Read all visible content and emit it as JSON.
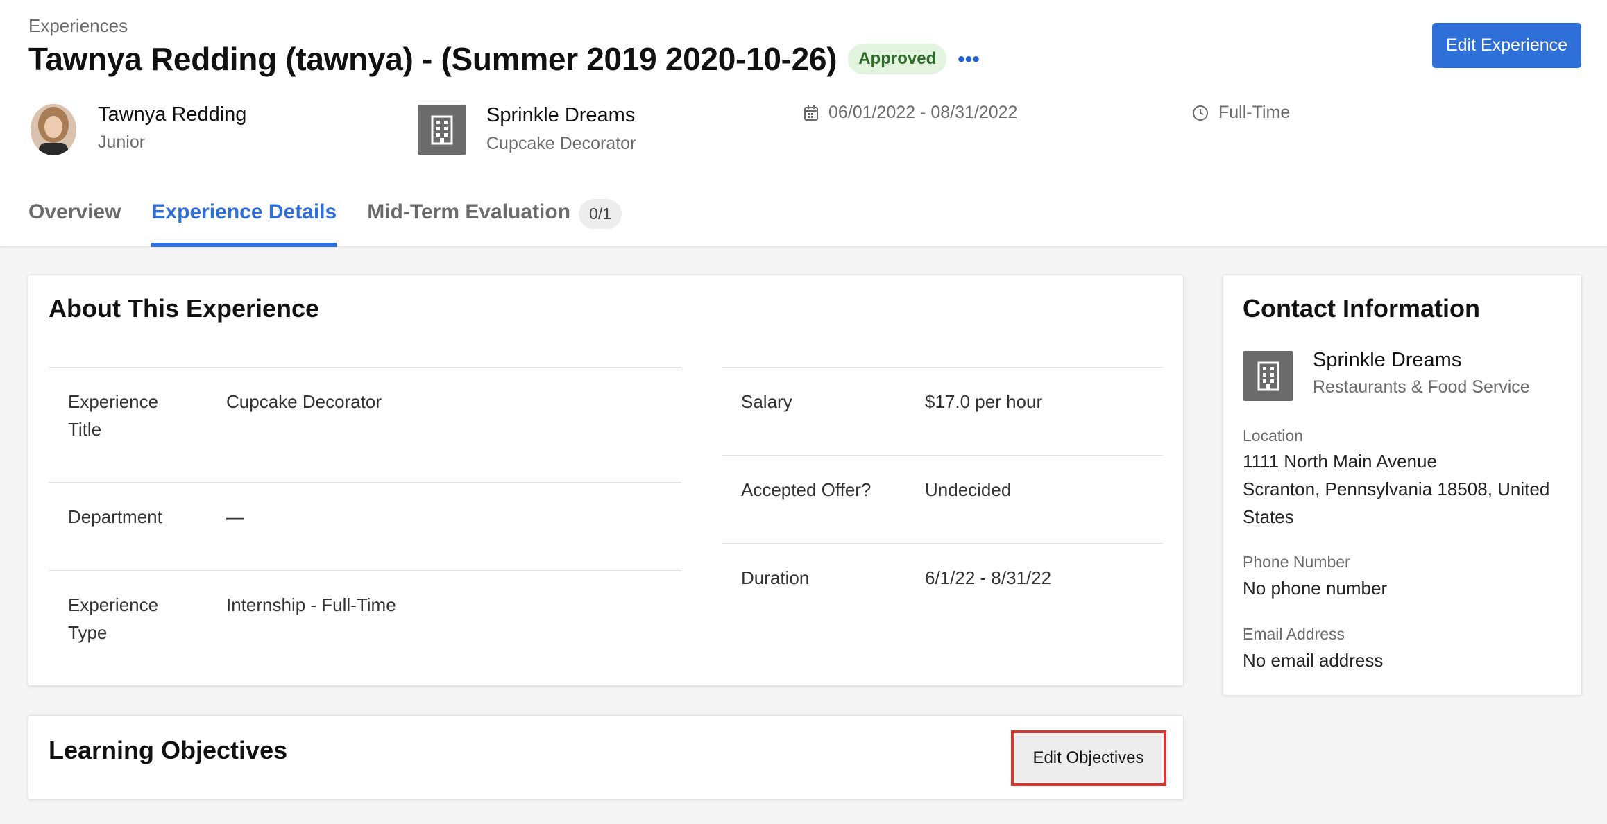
{
  "header": {
    "breadcrumb": "Experiences",
    "title": "Tawnya Redding (tawnya) - (Summer 2019 2020-10-26)",
    "status": "Approved",
    "more": "•••",
    "edit_button": "Edit Experience"
  },
  "student": {
    "name": "Tawnya Redding",
    "year": "Junior"
  },
  "employer": {
    "name": "Sprinkle Dreams",
    "job_title": "Cupcake Decorator"
  },
  "dates": "06/01/2022 - 08/31/2022",
  "employment_type": "Full-Time",
  "tabs": [
    {
      "label": "Overview"
    },
    {
      "label": "Experience Details"
    },
    {
      "label": "Mid-Term Evaluation",
      "count": "0/1"
    }
  ],
  "about": {
    "title": "About This Experience",
    "left": [
      {
        "label": "Experience Title",
        "value": "Cupcake Decorator"
      },
      {
        "label": "Department",
        "value": "—"
      },
      {
        "label": "Experience Type",
        "value": "Internship - Full-Time"
      }
    ],
    "right": [
      {
        "label": "Salary",
        "value": "$17.0 per hour"
      },
      {
        "label": "Accepted Offer?",
        "value": "Undecided"
      },
      {
        "label": "Duration",
        "value": "6/1/22 - 8/31/22"
      }
    ]
  },
  "contact": {
    "title": "Contact Information",
    "company": "Sprinkle Dreams",
    "industry": "Restaurants & Food Service",
    "location_label": "Location",
    "address_line1": "1111 North Main Avenue",
    "address_line2": "Scranton, Pennsylvania 18508, United States",
    "phone_label": "Phone Number",
    "phone": "No phone number",
    "email_label": "Email Address",
    "email": "No email address"
  },
  "objectives": {
    "title": "Learning Objectives",
    "edit_button": "Edit Objectives"
  },
  "colors": {
    "accent": "#2f6fd8",
    "approved_bg": "#e2f3de",
    "approved_text": "#2f6b2a",
    "highlight": "#e0332c"
  }
}
